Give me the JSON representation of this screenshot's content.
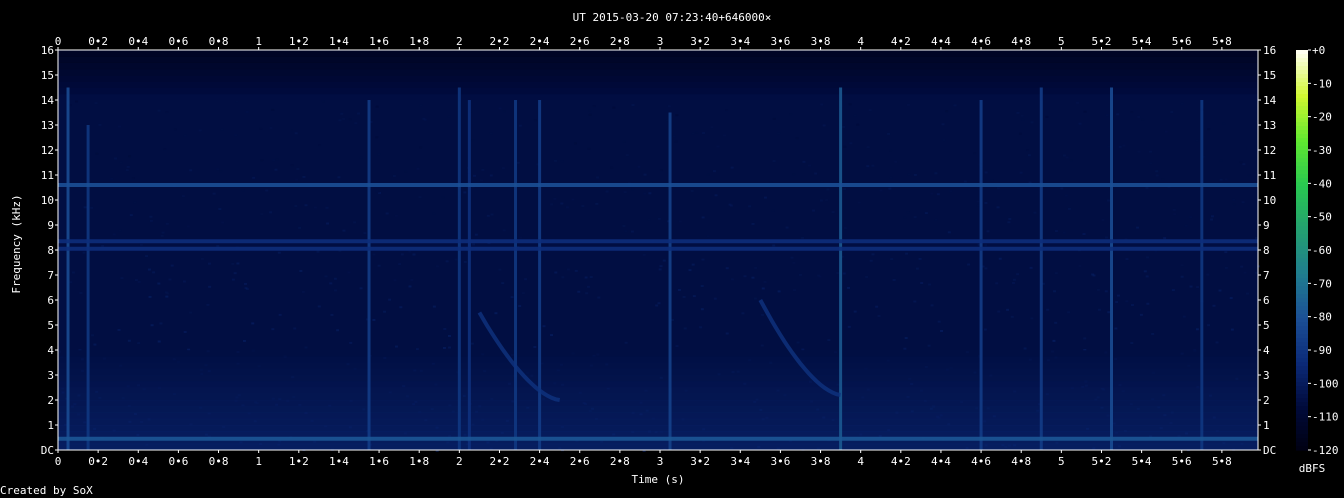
{
  "chart_data": {
    "type": "heatmap",
    "title": "UT 2015-03-20 07:23:40+646000×",
    "xlabel": "Time (s)",
    "ylabel": "Frequency (kHz)",
    "xlim": [
      0,
      5.98
    ],
    "ylim": [
      0,
      16
    ],
    "x_ticks": [
      "0",
      "0•2",
      "0•4",
      "0•6",
      "0•8",
      "1",
      "1•2",
      "1•4",
      "1•6",
      "1•8",
      "2",
      "2•2",
      "2•4",
      "2•6",
      "2•8",
      "3",
      "3•2",
      "3•4",
      "3•6",
      "3•8",
      "4",
      "4•2",
      "4•4",
      "4•6",
      "4•8",
      "5",
      "5•2",
      "5•4",
      "5•6",
      "5•8"
    ],
    "y_ticks": [
      "DC",
      "1",
      "2",
      "3",
      "4",
      "5",
      "6",
      "7",
      "8",
      "9",
      "10",
      "11",
      "12",
      "13",
      "14",
      "15",
      "16"
    ],
    "colorbar": {
      "label": "dBFS",
      "range": [
        -120,
        0
      ],
      "ticks": [
        "+0",
        "-10",
        "-20",
        "-30",
        "-40",
        "-50",
        "-60",
        "-70",
        "-80",
        "-90",
        "-100",
        "-110",
        "-120"
      ]
    },
    "background_level_db": -105,
    "steady_tones": [
      {
        "freq_khz": 10.6,
        "level_db": -80
      },
      {
        "freq_khz": 8.35,
        "level_db": -92
      },
      {
        "freq_khz": 8.05,
        "level_db": -92
      },
      {
        "freq_khz": 0.45,
        "level_db": -78
      }
    ],
    "impulses": [
      {
        "t": 0.05,
        "fmax": 14.5,
        "level_db": -80
      },
      {
        "t": 0.15,
        "fmax": 13.0,
        "level_db": -88
      },
      {
        "t": 1.55,
        "fmax": 14.0,
        "level_db": -86
      },
      {
        "t": 2.0,
        "fmax": 14.5,
        "level_db": -88
      },
      {
        "t": 2.05,
        "fmax": 14.0,
        "level_db": -90
      },
      {
        "t": 2.28,
        "fmax": 14.0,
        "level_db": -88
      },
      {
        "t": 2.4,
        "fmax": 14.0,
        "level_db": -86
      },
      {
        "t": 3.05,
        "fmax": 13.5,
        "level_db": -84
      },
      {
        "t": 3.9,
        "fmax": 14.5,
        "level_db": -76
      },
      {
        "t": 4.6,
        "fmax": 14.0,
        "level_db": -86
      },
      {
        "t": 4.9,
        "fmax": 14.5,
        "level_db": -86
      },
      {
        "t": 5.25,
        "fmax": 14.5,
        "level_db": -80
      },
      {
        "t": 5.7,
        "fmax": 14.0,
        "level_db": -88
      }
    ],
    "sweeps": [
      {
        "t_start": 2.1,
        "t_end": 2.5,
        "f_start_khz": 5.5,
        "f_end_khz": 2.0
      },
      {
        "t_start": 3.5,
        "t_end": 3.9,
        "f_start_khz": 6.0,
        "f_end_khz": 2.2
      }
    ],
    "colors": {
      "background": "#000000",
      "text": "#ffffff",
      "colormap": [
        "#000010",
        "#000a3a",
        "#0b2a78",
        "#1b4f96",
        "#1f7d8f",
        "#23a070",
        "#28c850",
        "#60e830",
        "#d0f830",
        "#fffff0"
      ]
    }
  },
  "footer": {
    "credit": "Created by SoX"
  }
}
